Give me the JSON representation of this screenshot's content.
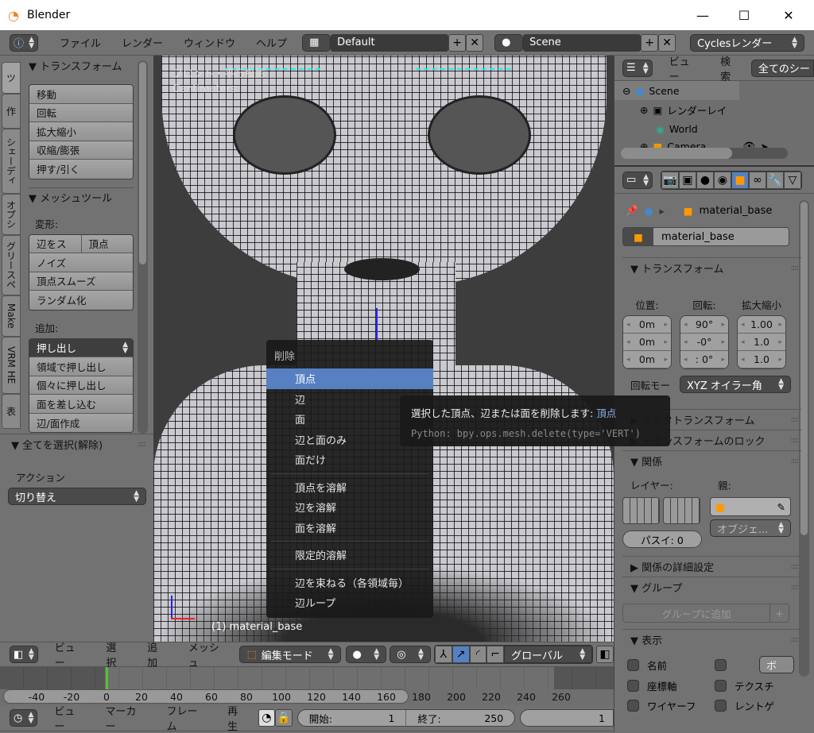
{
  "window": {
    "title": "Blender",
    "minimize": "—",
    "maximize": "☐",
    "close": "✕"
  },
  "top_header": {
    "menus": [
      "ファイル",
      "レンダー",
      "ウィンドウ",
      "ヘルプ"
    ],
    "layout": "Default",
    "scene": "Scene",
    "engine": "Cyclesレンダー"
  },
  "left_tabs": [
    "ツ",
    "作",
    "シェーディ",
    "オプシ",
    "グリースペ",
    "Make",
    "VRM HE",
    "表"
  ],
  "tool_panel": {
    "transform_title": "▼ トランスフォーム",
    "transform_buttons": [
      "移動",
      "回転",
      "拡大縮小",
      "収縮/膨張",
      "押す/引く"
    ],
    "mesh_title": "▼ メッシュツール",
    "deform_label": "変形:",
    "deform_row": [
      "辺をス",
      "頂点"
    ],
    "deform_buttons": [
      "ノイズ",
      "頂点スムーズ",
      "ランダム化"
    ],
    "add_label": "追加:",
    "add_select": "押し出し",
    "add_buttons": [
      "領域で押し出し",
      "個々に押し出し",
      "面を差し込む",
      "辺/面作成"
    ]
  },
  "operator_panel": {
    "title": "▼ 全てを選択(解除)",
    "action_label": "アクション",
    "action_value": "切り替え"
  },
  "viewport": {
    "view_name": "フロント・平行投影",
    "units": "Centimeters",
    "object_label": "(1) material_base"
  },
  "delete_menu": {
    "title": "削除",
    "items": [
      [
        "頂点",
        "辺",
        "面",
        "辺と面のみ",
        "面だけ"
      ],
      [
        "頂点を溶解",
        "辺を溶解",
        "面を溶解"
      ],
      [
        "限定的溶解"
      ],
      [
        "辺を束ねる（各領域毎）",
        "辺ループ"
      ]
    ],
    "highlighted": "頂点"
  },
  "tooltip": {
    "text": "選択した頂点、辺または面を削除します:",
    "value": "頂点",
    "python": "Python: bpy.ops.mesh.delete(type='VERT')"
  },
  "outliner": {
    "view": "ビュー",
    "search": "検索",
    "filter": "全てのシー",
    "items": [
      "Scene",
      "レンダーレイ",
      "World",
      "Camera"
    ]
  },
  "properties": {
    "breadcrumb": "material_base",
    "object_name": "material_base",
    "transform_title": "▼ トランスフォーム",
    "location_label": "位置:",
    "rotation_label": "回転:",
    "scale_label": "拡大縮小",
    "location": [
      "0m",
      "0m",
      "0m"
    ],
    "rotation": [
      "90°",
      "-0°",
      ": 0°"
    ],
    "scale": [
      "1.00",
      "1.0",
      "1.0"
    ],
    "rotation_mode_label": "回転モー",
    "rotation_mode": "XYZ オイラー角",
    "delta_title": "▶ デルタトランスフォーム",
    "lock_title": "▶ トランスフォームのロック",
    "relations_title": "▼ 関係",
    "layer_label": "レイヤー:",
    "parent_label": "親:",
    "parent_type": "オブジェ...",
    "pass_index": "パスイ: 0",
    "relations_extras_title": "▶ 関係の詳細設定",
    "groups_title": "▼ グループ",
    "add_group": "グループに追加",
    "add_group_plus": "+",
    "display_title": "▼ 表示",
    "display_checks": [
      "名前",
      "座標軸",
      "ワイヤーフ"
    ],
    "display_checks_right": [
      "",
      "テクスチ",
      "レントゲ"
    ],
    "display_select": "ボ"
  },
  "view3d_header": {
    "menus": [
      "ビュー",
      "選択",
      "追加",
      "メッシュ"
    ],
    "mode": "編集モード",
    "orientation": "グローバル"
  },
  "timeline": {
    "ticks": [
      "-40",
      "-20",
      "0",
      "20",
      "40",
      "60",
      "80",
      "100",
      "120",
      "140",
      "160",
      "180",
      "200",
      "220",
      "240",
      "260"
    ],
    "current_frame": 0
  },
  "timeline_header": {
    "menus": [
      "ビュー",
      "マーカー",
      "フレーム",
      "再生"
    ],
    "start_label": "開始:",
    "start": "1",
    "end_label": "終了:",
    "end": "250",
    "current": "1"
  },
  "colors": {
    "accent": "#5680c2",
    "panel": "#727272",
    "playhead": "#52c234",
    "active_tab": "#5680c2"
  }
}
